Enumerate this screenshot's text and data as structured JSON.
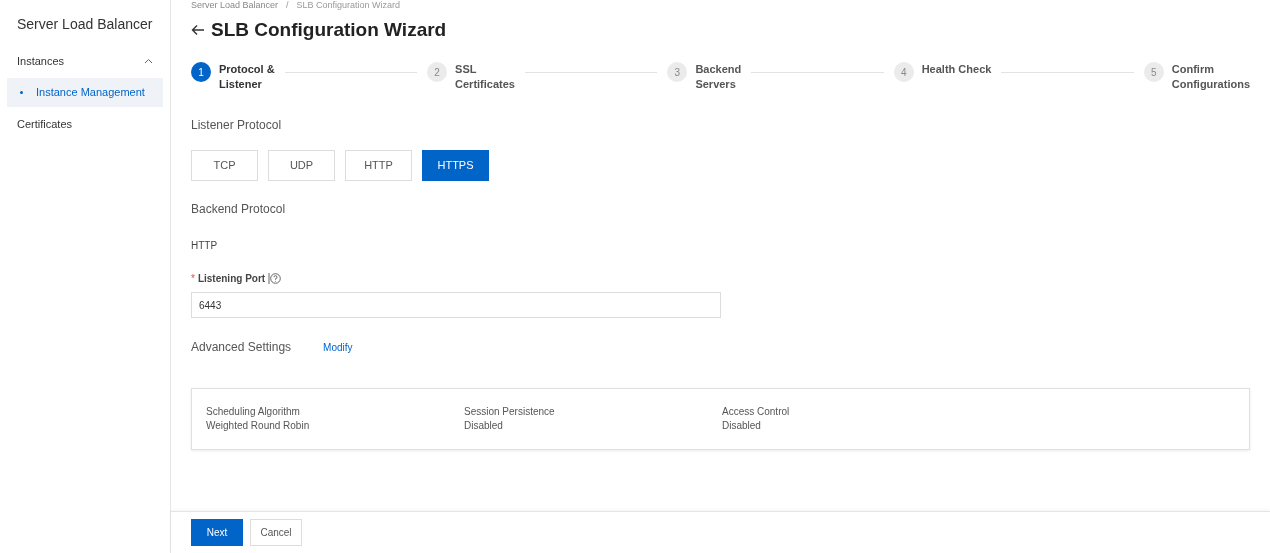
{
  "breadcrumb": {
    "items": [
      "Server Load Balancer",
      "SLB Configuration Wizard"
    ],
    "separator": "/"
  },
  "sidebar": {
    "title": "Server Load Balancer",
    "groups": [
      {
        "label": "Instances",
        "expanded": true,
        "items": [
          {
            "label": "Instance Management",
            "selected": true
          }
        ]
      },
      {
        "label": "Certificates"
      }
    ]
  },
  "title": "SLB Configuration Wizard",
  "steps": [
    {
      "number": "1",
      "label": [
        "Protocol &",
        "Listener"
      ],
      "selected": true
    },
    {
      "number": "2",
      "label": [
        "SSL",
        "Certificates"
      ],
      "selected": false
    },
    {
      "number": "3",
      "label": [
        "Backend",
        "Servers"
      ],
      "selected": false
    },
    {
      "number": "4",
      "label": [
        "Health Check"
      ],
      "selected": false
    },
    {
      "number": "5",
      "label": [
        "Confirm",
        "Configurations"
      ],
      "selected": false
    }
  ],
  "listener_protocol": {
    "label": "Listener Protocol",
    "options": [
      {
        "label": "TCP",
        "selected": false
      },
      {
        "label": "UDP",
        "selected": false
      },
      {
        "label": "HTTP",
        "selected": false
      },
      {
        "label": "HTTPS",
        "selected": true
      }
    ]
  },
  "backend_protocol": {
    "label": "Backend Protocol",
    "value": "HTTP"
  },
  "listening_port": {
    "required_mark": "*",
    "label": "Listening Port",
    "value": "6443"
  },
  "advanced_settings": {
    "label": "Advanced Settings",
    "link": "Modify",
    "items": [
      {
        "label": "Scheduling Algorithm",
        "value": "Weighted Round Robin"
      },
      {
        "label": "Session Persistence",
        "value": "Disabled"
      },
      {
        "label": "Access Control",
        "value": "Disabled"
      }
    ]
  },
  "buttons": [
    {
      "label": "Next",
      "kind": "primary"
    },
    {
      "label": "Cancel",
      "kind": "secondary"
    }
  ]
}
